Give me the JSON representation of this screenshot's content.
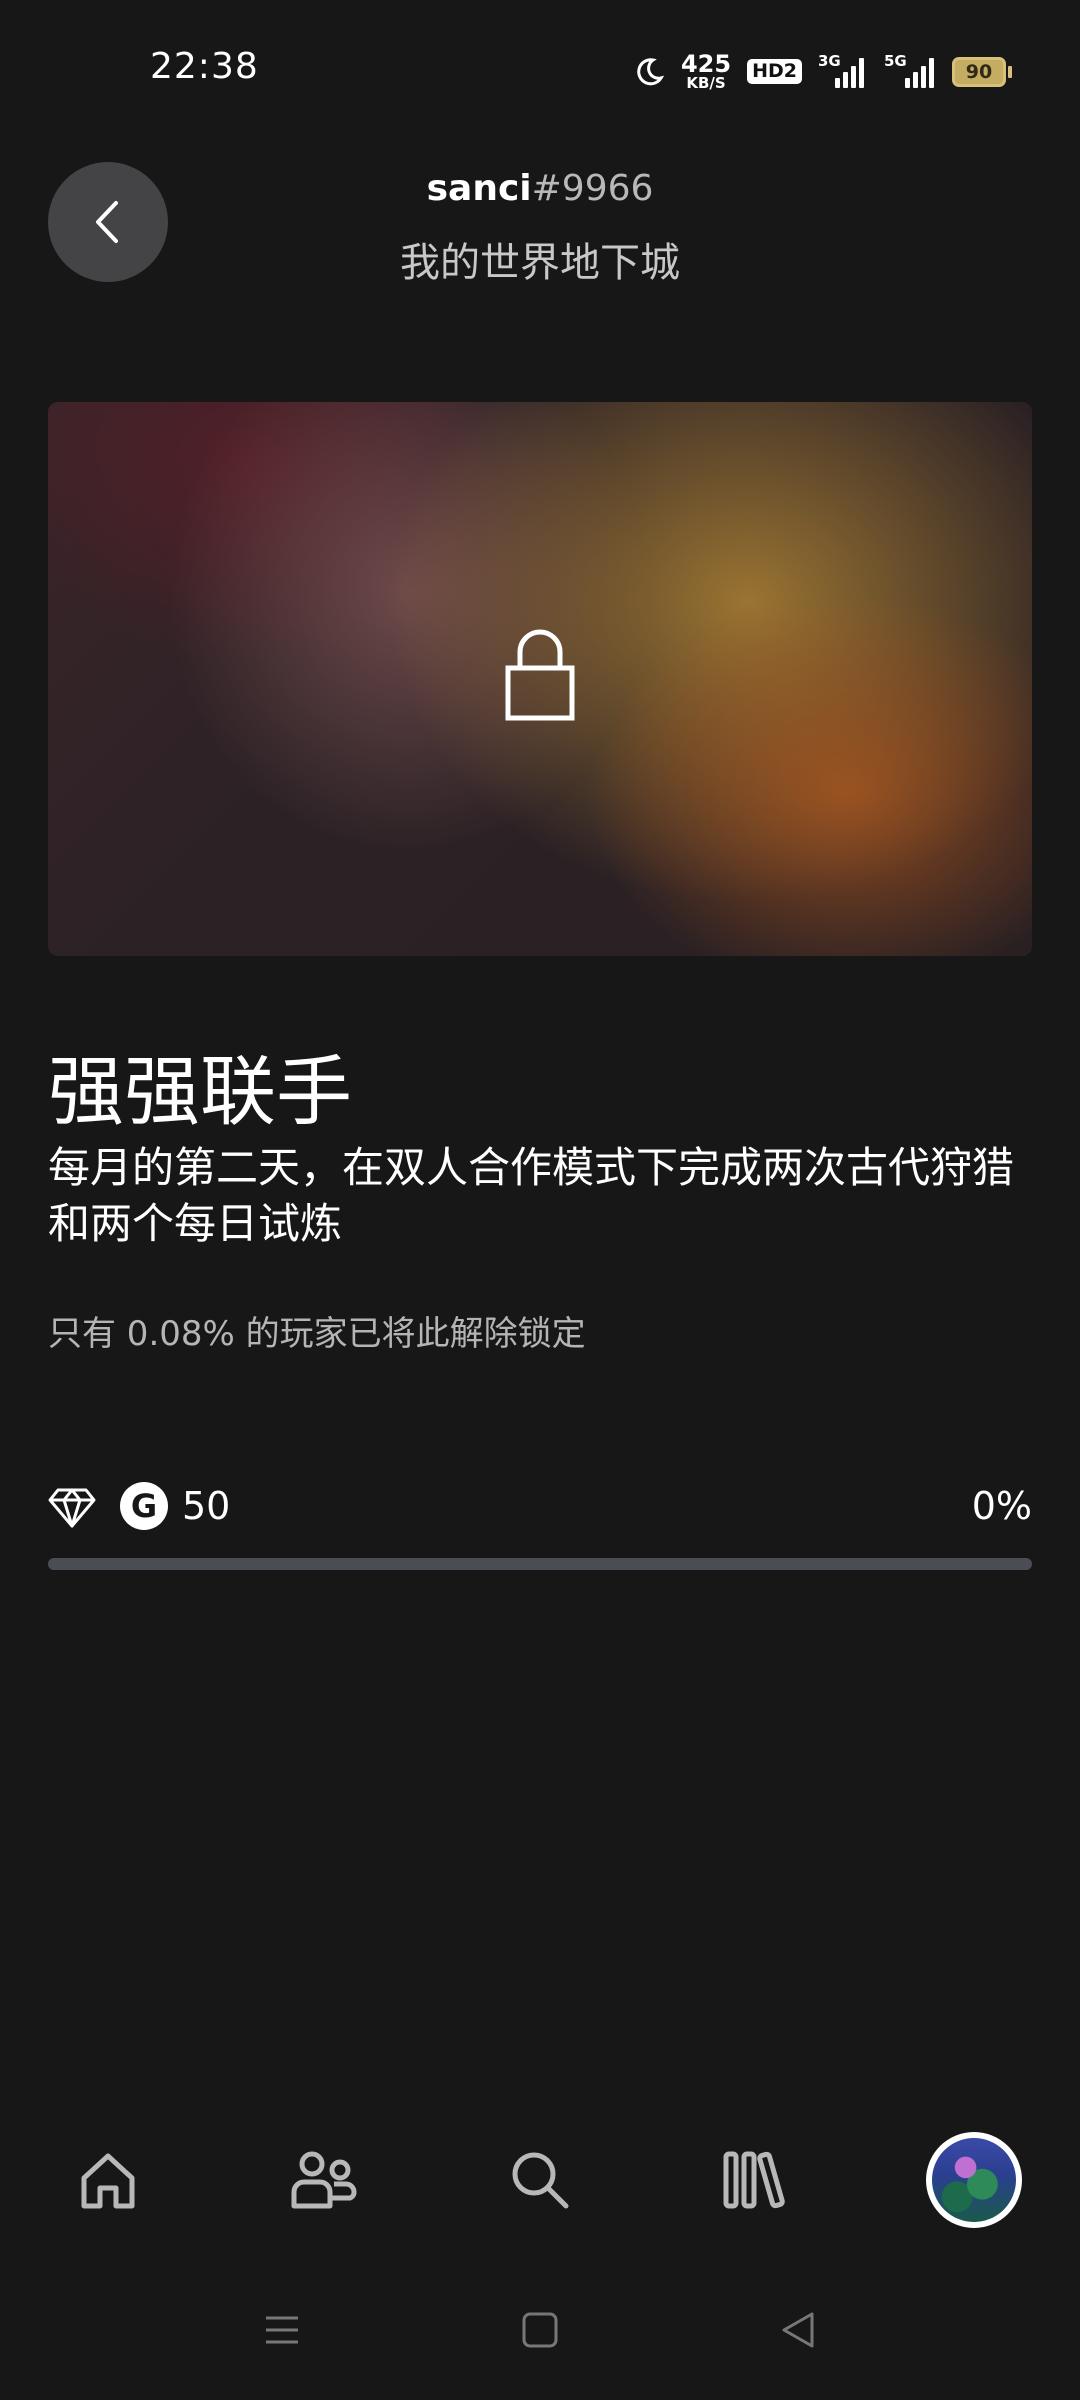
{
  "status_bar": {
    "time": "22:38",
    "net_speed_value": "425",
    "net_speed_unit": "KB/S",
    "hd_badge": "HD2",
    "sim1_label": "3G",
    "sim2_label": "5G",
    "battery_level": "90"
  },
  "header": {
    "gamertag": "sanci",
    "gamertag_suffix": "#9966",
    "game_name": "我的世界地下城"
  },
  "achievement": {
    "title": "强强联手",
    "description": "每月的第二天，在双人合作模式下完成两次古代狩猎和两个每日试炼",
    "rarity_text": "只有 0.08% 的玩家已将此解除锁定",
    "gamerscore_icon": "G",
    "gamerscore": "50",
    "progress_text": "0%",
    "progress_fraction": 0,
    "locked": true
  },
  "bottom_nav": {
    "items": [
      {
        "icon": "home-icon"
      },
      {
        "icon": "friends-icon"
      },
      {
        "icon": "search-icon"
      },
      {
        "icon": "library-icon"
      },
      {
        "icon": "profile-avatar"
      }
    ]
  },
  "system_nav": {
    "items": [
      "menu-icon",
      "home-square-icon",
      "back-triangle-icon"
    ]
  },
  "colors": {
    "background": "#171718",
    "back_button": "#444446",
    "progress_track": "#4a4e54",
    "battery": "#c4ad63"
  }
}
